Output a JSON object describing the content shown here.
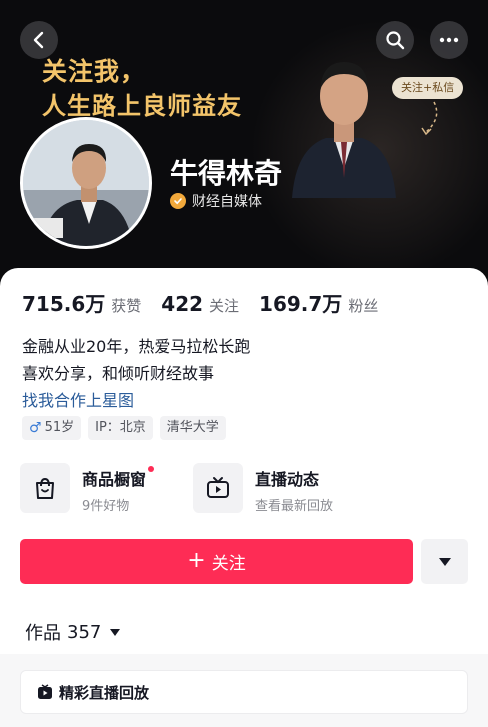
{
  "header": {
    "banner_line1": "关注我，",
    "banner_line2": "人生路上良师益友",
    "follow_message_pill": "关注+私信",
    "icons": {
      "back": "back-chevron-icon",
      "search": "search-icon",
      "more": "more-dots-icon"
    }
  },
  "profile": {
    "username": "牛得林奇",
    "verification": "财经自媒体",
    "verify_icon": "verified-check-icon"
  },
  "stats": [
    {
      "value": "715.6万",
      "label": "获赞"
    },
    {
      "value": "422",
      "label": "关注"
    },
    {
      "value": "169.7万",
      "label": "粉丝"
    }
  ],
  "bio": {
    "line1": "金融从业20年，热爱马拉松长跑",
    "line2": "喜欢分享，和倾听财经故事",
    "link": "找我合作上星图"
  },
  "tags": {
    "gender_symbol": "♂",
    "age": "51岁",
    "ip": "IP：北京",
    "school": "清华大学"
  },
  "features": [
    {
      "title": "商品橱窗",
      "subtitle": "9件好物",
      "icon": "shopping-bag-icon",
      "has_red_dot": true
    },
    {
      "title": "直播动态",
      "subtitle": "查看最新回放",
      "icon": "live-tv-icon",
      "has_red_dot": false
    }
  ],
  "actions": {
    "follow_label": "关注",
    "follow_plus": "+",
    "dropdown_icon": "triangle-down-icon"
  },
  "works": {
    "label": "作品",
    "count": "357"
  },
  "replay": {
    "label": "精彩直播回放",
    "icon": "live-replay-icon"
  },
  "colors": {
    "accent": "#fe2c55",
    "banner_text": "#f3c46a",
    "link": "#2b5c9a",
    "verify_badge": "#f2a93b"
  }
}
